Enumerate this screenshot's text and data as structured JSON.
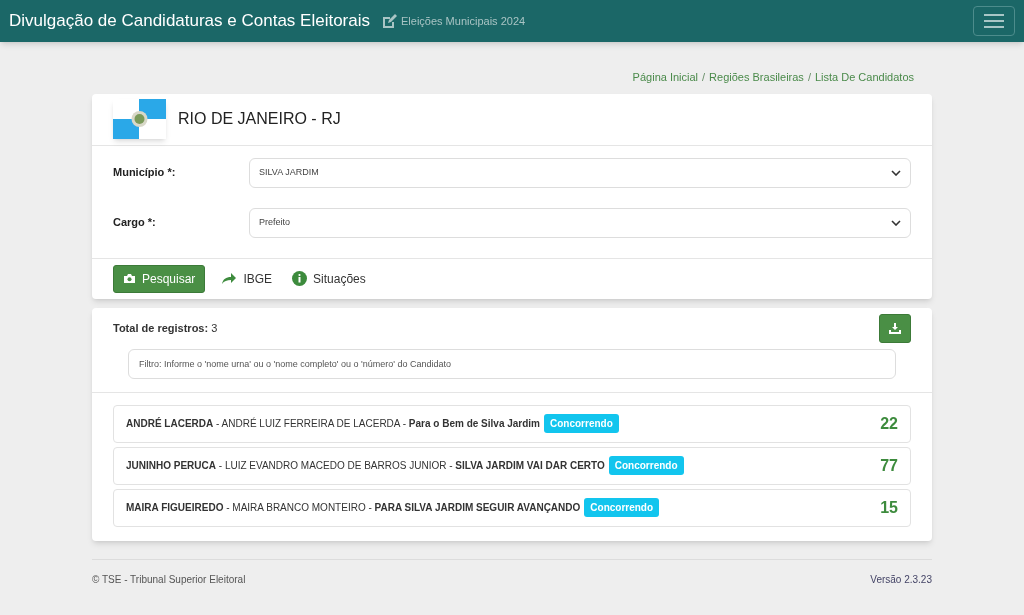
{
  "header": {
    "title": "Divulgação de Candidaturas e Contas Eleitorais",
    "subtitle": "Eleições Municipais 2024"
  },
  "breadcrumb": {
    "separator": "/",
    "items": [
      "Página Inicial",
      "Regiões Brasileiras",
      "Lista De Candidatos"
    ]
  },
  "state": {
    "name": "RIO DE JANEIRO - RJ"
  },
  "fields": [
    {
      "label": "Município *:",
      "value": "SILVA JARDIM"
    },
    {
      "label": "Cargo *:",
      "value": "Prefeito"
    }
  ],
  "actions": [
    {
      "kind": "primary",
      "label": "Pesquisar"
    },
    {
      "kind": "share",
      "label": "IBGE"
    },
    {
      "kind": "info",
      "label": "Situações"
    }
  ],
  "results": {
    "total_label": "Total de registros:",
    "total": "3",
    "filter_placeholder": "Filtro: Informe o 'nome urna' ou o 'nome completo' ou o 'número' do Candidato",
    "candidates": [
      {
        "text": "**ANDRÉ LACERDA** - ANDRÉ LUIZ FERREIRA DE LACERDA - **Para o Bem de Silva Jardim**",
        "status": "Concorrendo",
        "number": "22"
      },
      {
        "text": "**JUNINHO PERUCA** - LUIZ EVANDRO MACEDO DE BARROS JUNIOR - **SILVA JARDIM VAI DAR CERTO**",
        "status": "Concorrendo",
        "number": "77"
      },
      {
        "text": "**MAIRA FIGUEIREDO** - MAIRA BRANCO MONTEIRO - **PARA SILVA JARDIM SEGUIR AVANÇANDO**",
        "status": "Concorrendo",
        "number": "15"
      }
    ]
  },
  "footer": {
    "left": "© TSE - Tribunal Superior Eleitoral",
    "right": "Versão 2.3.23"
  }
}
